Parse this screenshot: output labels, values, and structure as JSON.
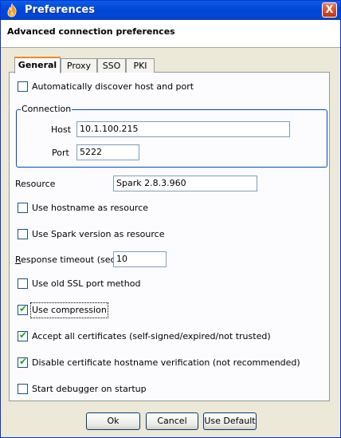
{
  "window": {
    "title": "Preferences",
    "close_symbol": "X"
  },
  "header": {
    "title": "Advanced connection preferences"
  },
  "tabs": [
    {
      "label": "General",
      "active": true
    },
    {
      "label": "Proxy",
      "active": false
    },
    {
      "label": "SSO",
      "active": false
    },
    {
      "label": "PKI",
      "active": false
    }
  ],
  "general": {
    "auto_discover": {
      "label": "Automatically discover host and port",
      "checked": false
    },
    "connection": {
      "title": "Connection",
      "host_label": "Host",
      "host_value": "10.1.100.215",
      "port_label": "Port",
      "port_value": "5222"
    },
    "resource": {
      "label": "Resource",
      "value": "Spark 2.8.3.960"
    },
    "use_hostname": {
      "label": "Use hostname as resource",
      "checked": false
    },
    "use_spark_version": {
      "label": "Use Spark version as resource",
      "checked": false
    },
    "response_timeout": {
      "label_mnemonic": "R",
      "label_rest": "esponse timeout (sec)",
      "value": "10"
    },
    "old_ssl": {
      "label": "Use old SSL port method",
      "checked": false
    },
    "compression": {
      "label": "Use compression",
      "checked": true
    },
    "accept_certs": {
      "label": "Accept all certificates (self-signed/expired/not trusted)",
      "checked": true
    },
    "disable_hostname_verif": {
      "label": "Disable certificate hostname verification (not recommended)",
      "checked": true
    },
    "debugger": {
      "label": "Start debugger on startup",
      "checked": false
    }
  },
  "buttons": {
    "ok": "Ok",
    "cancel": "Cancel",
    "use_default": "Use Default"
  },
  "colors": {
    "titlebar": "#0054e3",
    "dialog_bg": "#ece9d8",
    "tab_accent": "#e68b2c",
    "check": "#21a121"
  }
}
